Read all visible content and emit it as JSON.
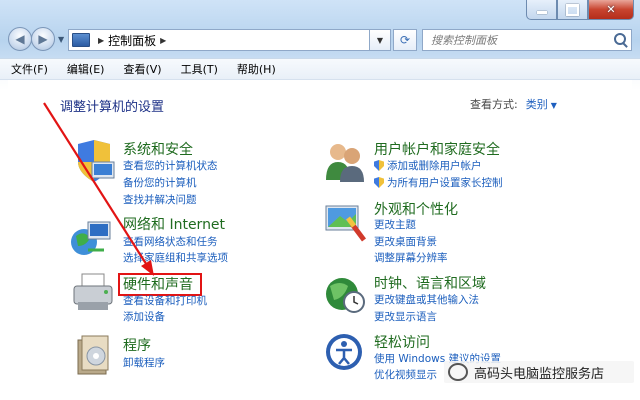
{
  "window": {
    "caption_buttons": [
      "minimize",
      "maximize",
      "close"
    ],
    "close_glyph": "✕"
  },
  "nav": {
    "back_glyph": "◀",
    "forward_glyph": "▶",
    "dropdown_glyph": "▼"
  },
  "address": {
    "sep_glyph": "▶",
    "crumbs": [
      "控制面板"
    ]
  },
  "search": {
    "placeholder": "搜索控制面板"
  },
  "menu": [
    "文件(F)",
    "编辑(E)",
    "查看(V)",
    "工具(T)",
    "帮助(H)"
  ],
  "page": {
    "heading": "调整计算机的设置",
    "view_by_label": "查看方式:",
    "view_by_value": "类别"
  },
  "categories": [
    {
      "title": "系统和安全",
      "links": [
        "查看您的计算机状态",
        "备份您的计算机",
        "查找并解决问题"
      ]
    },
    {
      "title": "网络和 Internet",
      "links": [
        "查看网络状态和任务",
        "选择家庭组和共享选项"
      ]
    },
    {
      "title": "硬件和声音",
      "links": [
        "查看设备和打印机",
        "添加设备"
      ]
    },
    {
      "title": "程序",
      "links": [
        "卸载程序"
      ]
    },
    {
      "title": "用户帐户和家庭安全",
      "links": [
        "添加或删除用户帐户",
        "为所有用户设置家长控制"
      ]
    },
    {
      "title": "外观和个性化",
      "links": [
        "更改主题",
        "更改桌面背景",
        "调整屏幕分辨率"
      ]
    },
    {
      "title": "时钟、语言和区域",
      "links": [
        "更改键盘或其他输入法",
        "更改显示语言"
      ]
    },
    {
      "title": "轻松访问",
      "links": [
        "使用 Windows 建议的设置",
        "优化视频显示"
      ]
    }
  ],
  "watermark": "高码头电脑监控服务店",
  "colors": {
    "link": "#1b5ebd",
    "category_title": "#1f6b1f",
    "highlight": "#e21414",
    "arrow": "#e21414"
  }
}
